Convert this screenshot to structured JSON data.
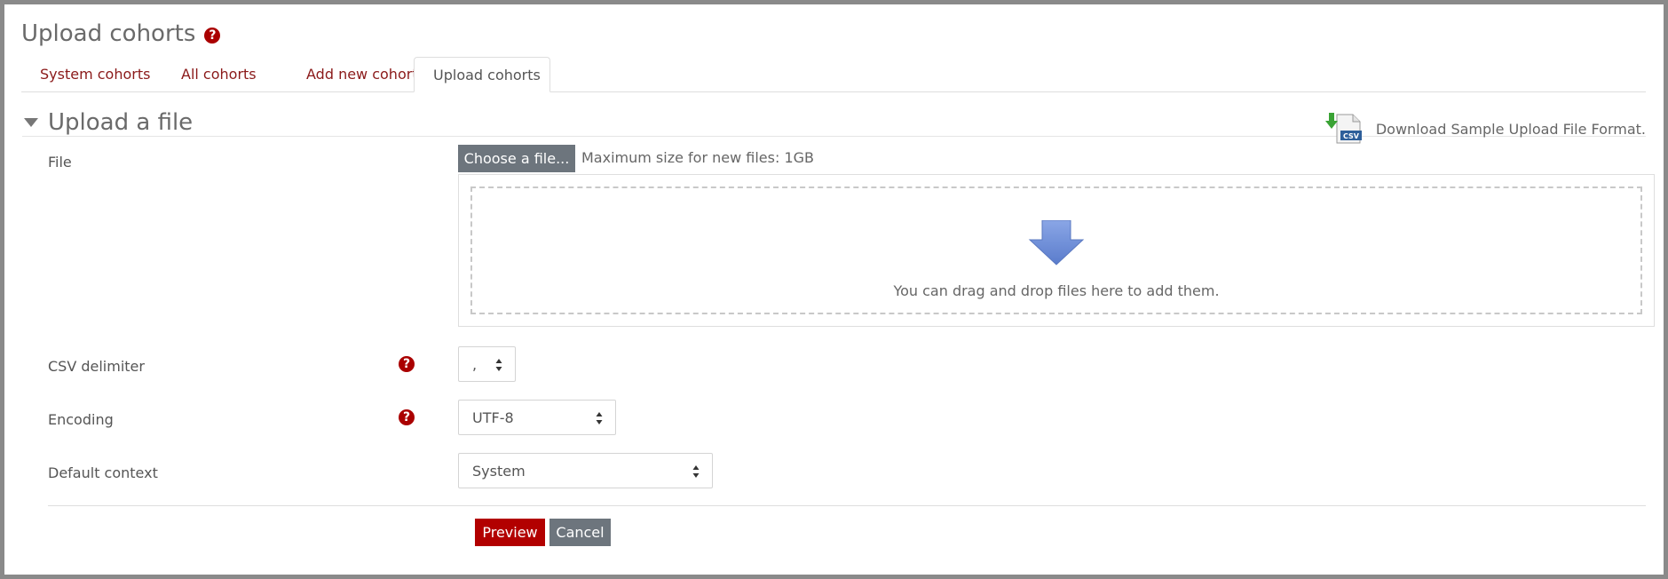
{
  "page": {
    "title": "Upload cohorts"
  },
  "tabs": [
    {
      "label": "System cohorts",
      "active": false
    },
    {
      "label": "All cohorts",
      "active": false
    },
    {
      "label": "Add new cohort",
      "active": false
    },
    {
      "label": "Upload cohorts",
      "active": true
    }
  ],
  "section": {
    "title": "Upload a file",
    "download_label": "Download Sample Upload File Format.",
    "csv_badge": "CSV"
  },
  "file": {
    "label": "File",
    "choose_button": "Choose a file...",
    "max_size": "Maximum size for new files: 1GB",
    "drop_text": "You can drag and drop files here to add them."
  },
  "csv_delimiter": {
    "label": "CSV delimiter",
    "value": ","
  },
  "encoding": {
    "label": "Encoding",
    "value": "UTF-8"
  },
  "default_context": {
    "label": "Default context",
    "value": "System"
  },
  "actions": {
    "preview": "Preview",
    "cancel": "Cancel"
  },
  "icons": {
    "help": "?"
  },
  "colors": {
    "link": "#8b1a1a",
    "help_icon": "#aa0000",
    "primary_button": "#b20000",
    "secondary_button": "#6d757d",
    "drop_arrow": "#6f8fd6"
  }
}
